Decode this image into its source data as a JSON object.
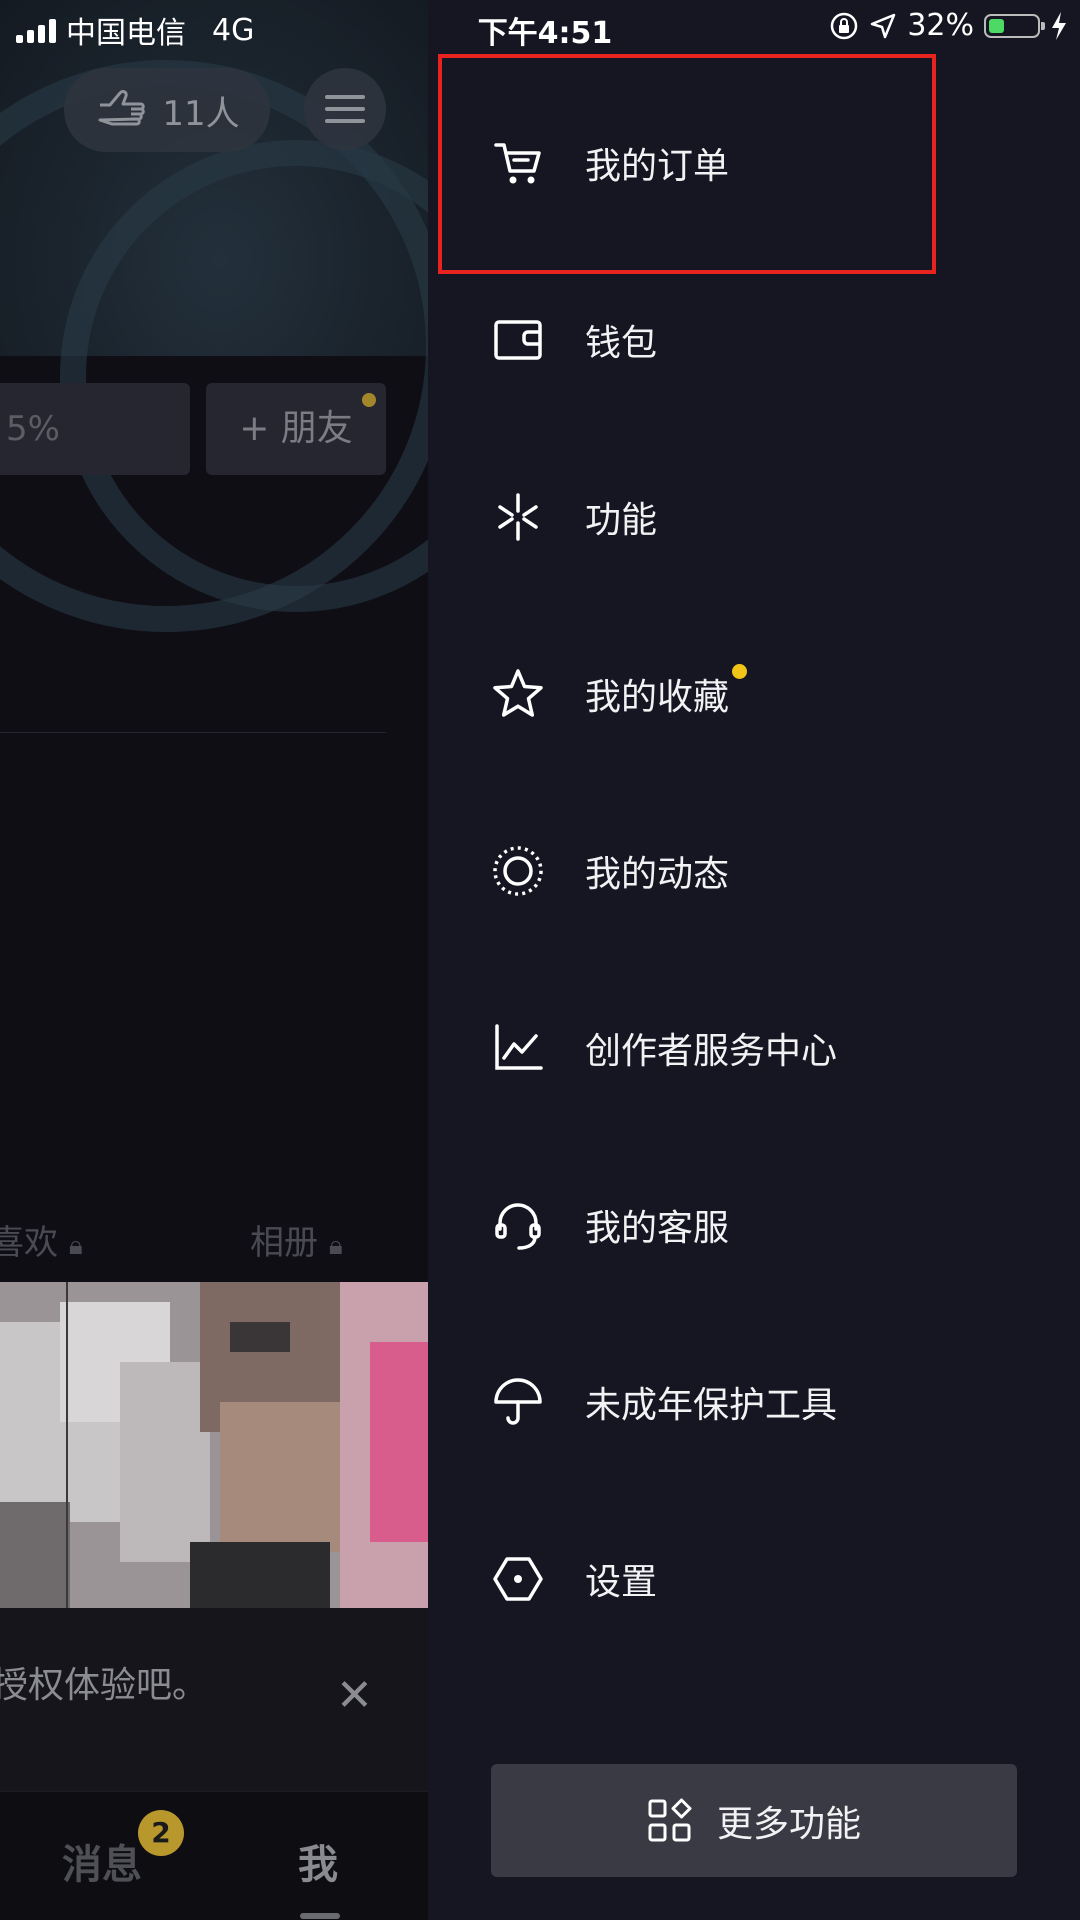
{
  "status_bar": {
    "carrier": "中国电信",
    "network": "4G",
    "time": "下午4:51",
    "battery": "32%",
    "battery_level": 0.32,
    "battery_color": "#4cd964"
  },
  "profile_page": {
    "visitors_count": "11人",
    "progress_text": "5%",
    "add_friend_label": "+ 朋友",
    "tab_likes": "喜欢",
    "tab_album": "相册",
    "notice_text": "授权体验吧。",
    "tabbar": {
      "messages_label": "消息",
      "messages_badge": "2",
      "me_label": "我"
    }
  },
  "drawer": {
    "items": [
      {
        "label": "我的订单",
        "icon": "cart-icon"
      },
      {
        "label": "钱包",
        "icon": "wallet-icon"
      },
      {
        "label": "功能",
        "icon": "sparkle-icon"
      },
      {
        "label": "我的收藏",
        "icon": "star-icon",
        "has_dot": true
      },
      {
        "label": "我的动态",
        "icon": "moments-circle-icon"
      },
      {
        "label": "创作者服务中心",
        "icon": "chart-icon"
      },
      {
        "label": "我的客服",
        "icon": "headset-icon"
      },
      {
        "label": "未成年保护工具",
        "icon": "umbrella-icon"
      },
      {
        "label": "设置",
        "icon": "settings-hexagon-icon"
      }
    ],
    "more_button_label": "更多功能",
    "highlight_color": "#e8231f",
    "notification_dot_color": "#f2c418"
  }
}
